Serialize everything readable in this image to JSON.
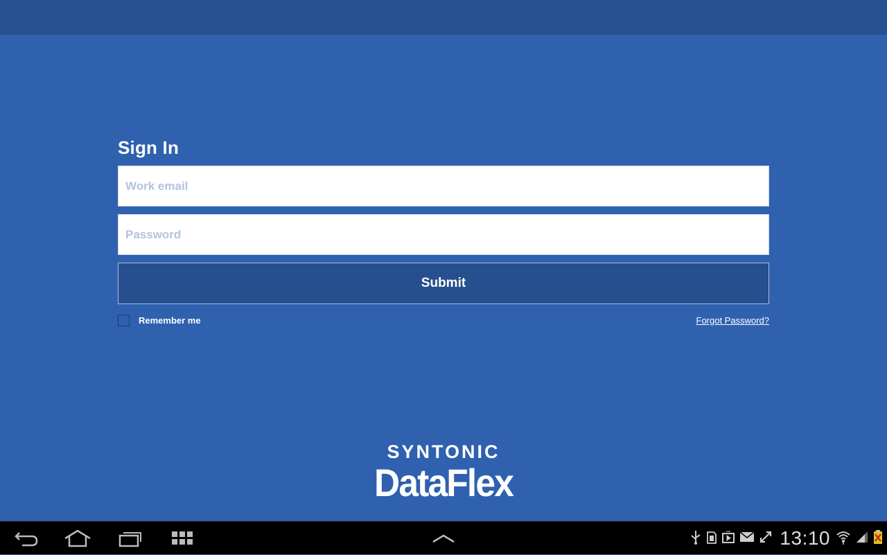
{
  "colors": {
    "background": "#2f61ae",
    "action_bar": "#275190",
    "button": "#264f8f",
    "nav_bar": "#000000"
  },
  "signin": {
    "title": "Sign In",
    "email_placeholder": "Work email",
    "password_placeholder": "Password",
    "submit_label": "Submit",
    "remember_label": "Remember me",
    "remember_checked": false,
    "forgot_label": "Forgot Password?"
  },
  "logo": {
    "line1": "SYNTONIC",
    "line2": "DataFlex"
  },
  "navbar": {
    "buttons": [
      "back-icon",
      "home-icon",
      "recent-apps-icon",
      "app-grid-icon",
      "chevron-up-icon"
    ],
    "status_icons": [
      "usb-icon",
      "sd-card-icon",
      "media-icon",
      "mail-icon",
      "sync-icon",
      "wifi-icon",
      "signal-icon",
      "battery-icon"
    ],
    "clock": "13:10"
  }
}
